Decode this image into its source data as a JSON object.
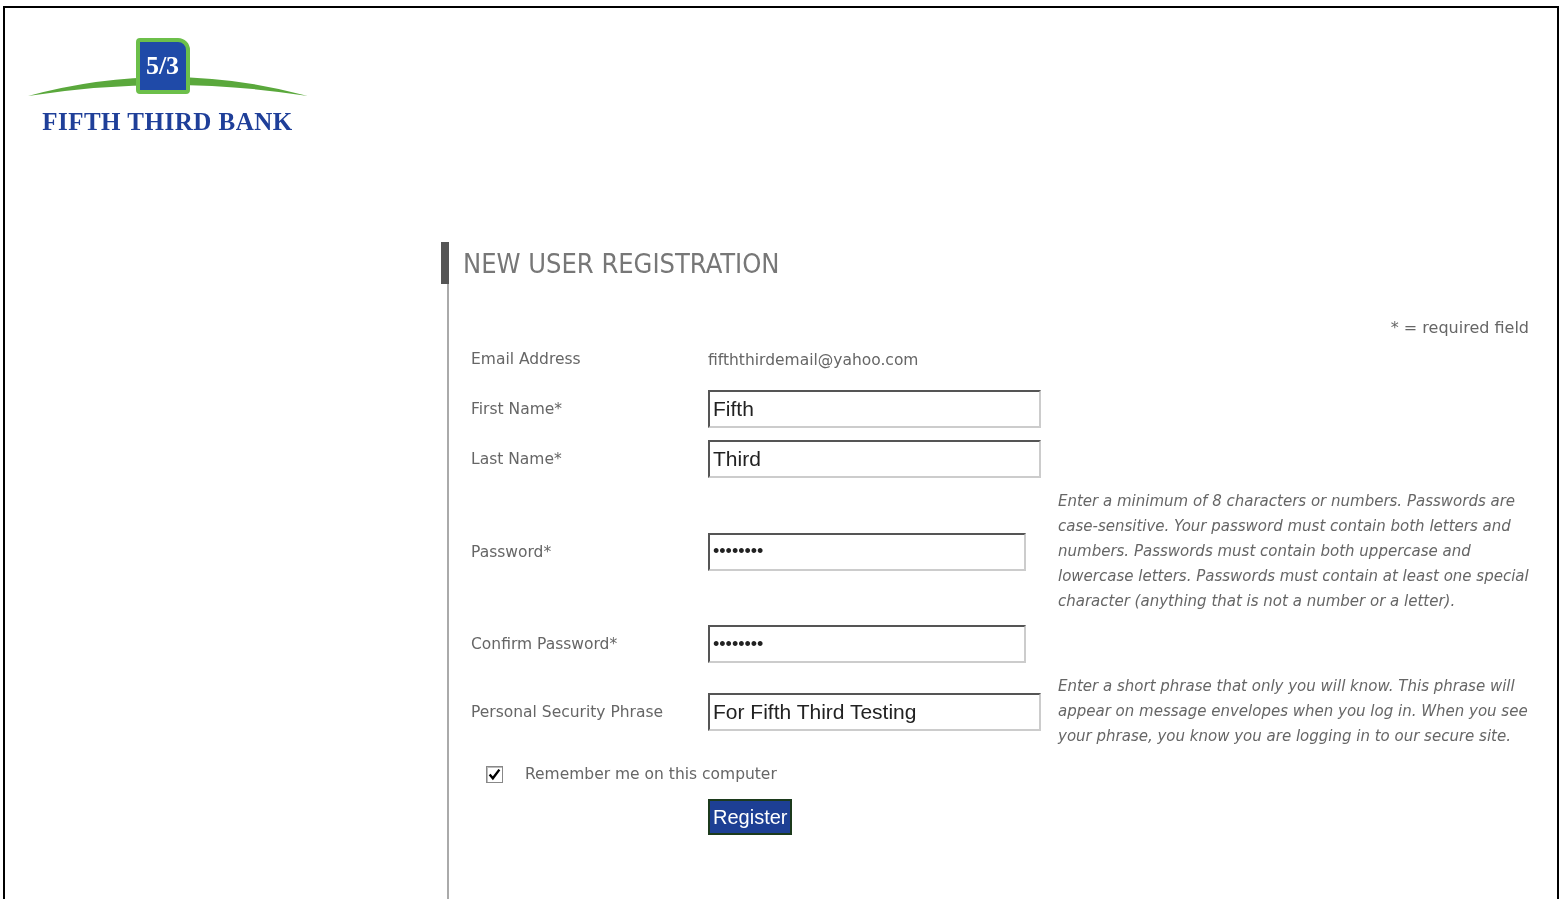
{
  "logo": {
    "mark": "5/3",
    "name": "FIFTH THIRD BANK"
  },
  "title": "NEW USER REGISTRATION",
  "required_note": "* = required field",
  "rows": [
    {
      "kind": "text",
      "label": "Email Address",
      "value": "fifththirdemail@yahoo.com"
    },
    {
      "kind": "input",
      "label": "First Name*",
      "value": "Fifth"
    },
    {
      "kind": "input",
      "label": "Last Name*",
      "value": "Third"
    },
    {
      "kind": "secret",
      "label": "Password*",
      "value": "••••••••",
      "hint": "Enter a minimum of 8 characters or numbers. Passwords are case-sensitive. Your password must contain both letters and numbers. Passwords must contain both uppercase and lowercase letters. Passwords must contain at least one special character (anything that is not a number or a letter)."
    },
    {
      "kind": "secret",
      "label": "Confirm Password*",
      "value": "••••••••"
    },
    {
      "kind": "input",
      "label": "Personal Security Phrase",
      "value": "For Fifth Third Testing",
      "hint": "Enter a short phrase that only you will know. This phrase will appear on message envelopes when you log in. When you see your phrase, you know you are logging in to our secure site."
    }
  ],
  "remember": {
    "label": "Remember me on this computer",
    "checked": true
  },
  "register_button": "Register"
}
